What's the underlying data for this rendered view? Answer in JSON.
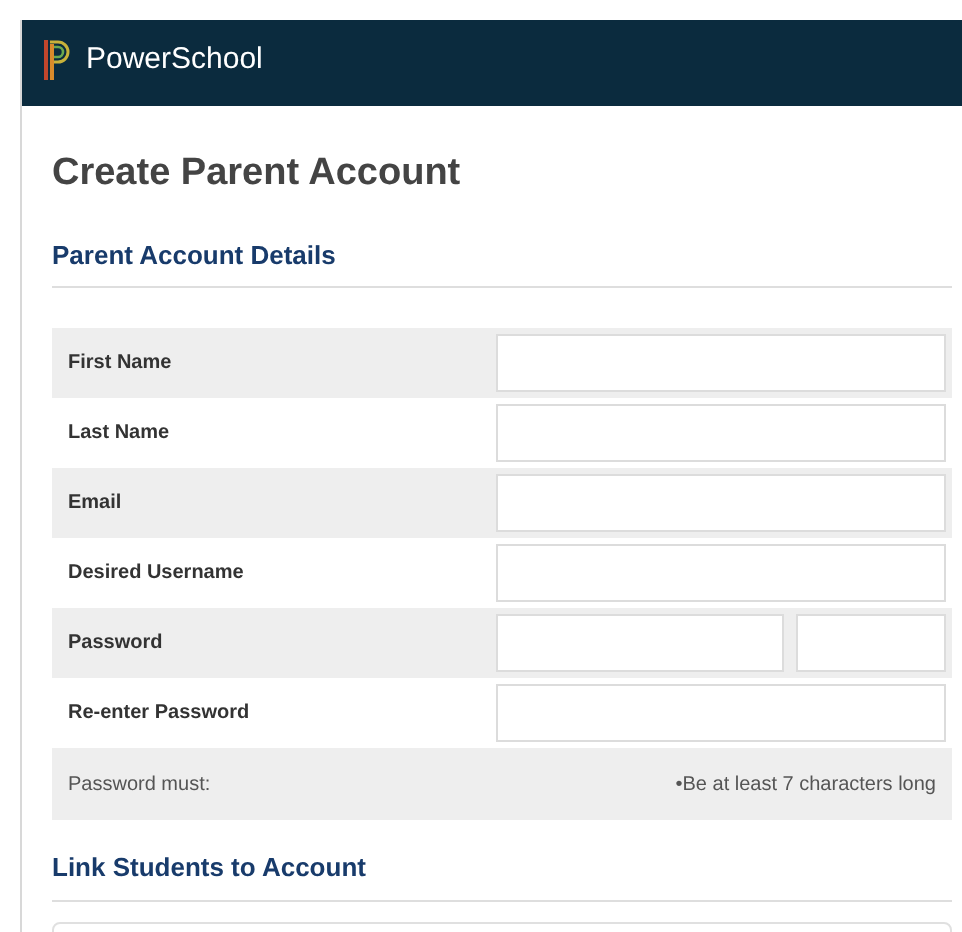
{
  "header": {
    "brand": "PowerSchool"
  },
  "page_title": "Create Parent Account",
  "sections": [
    {
      "title": "Parent Account Details",
      "rows": [
        {
          "label": "First Name",
          "kind": "text"
        },
        {
          "label": "Last Name",
          "kind": "text"
        },
        {
          "label": "Email",
          "kind": "text"
        },
        {
          "label": "Desired Username",
          "kind": "text"
        },
        {
          "label": "Password",
          "kind": "password_pair"
        },
        {
          "label": "Re-enter Password",
          "kind": "text"
        },
        {
          "label": "Password must:",
          "kind": "note",
          "note": "•Be at least 7 characters long"
        }
      ]
    },
    {
      "title": "Link Students to Account"
    }
  ]
}
